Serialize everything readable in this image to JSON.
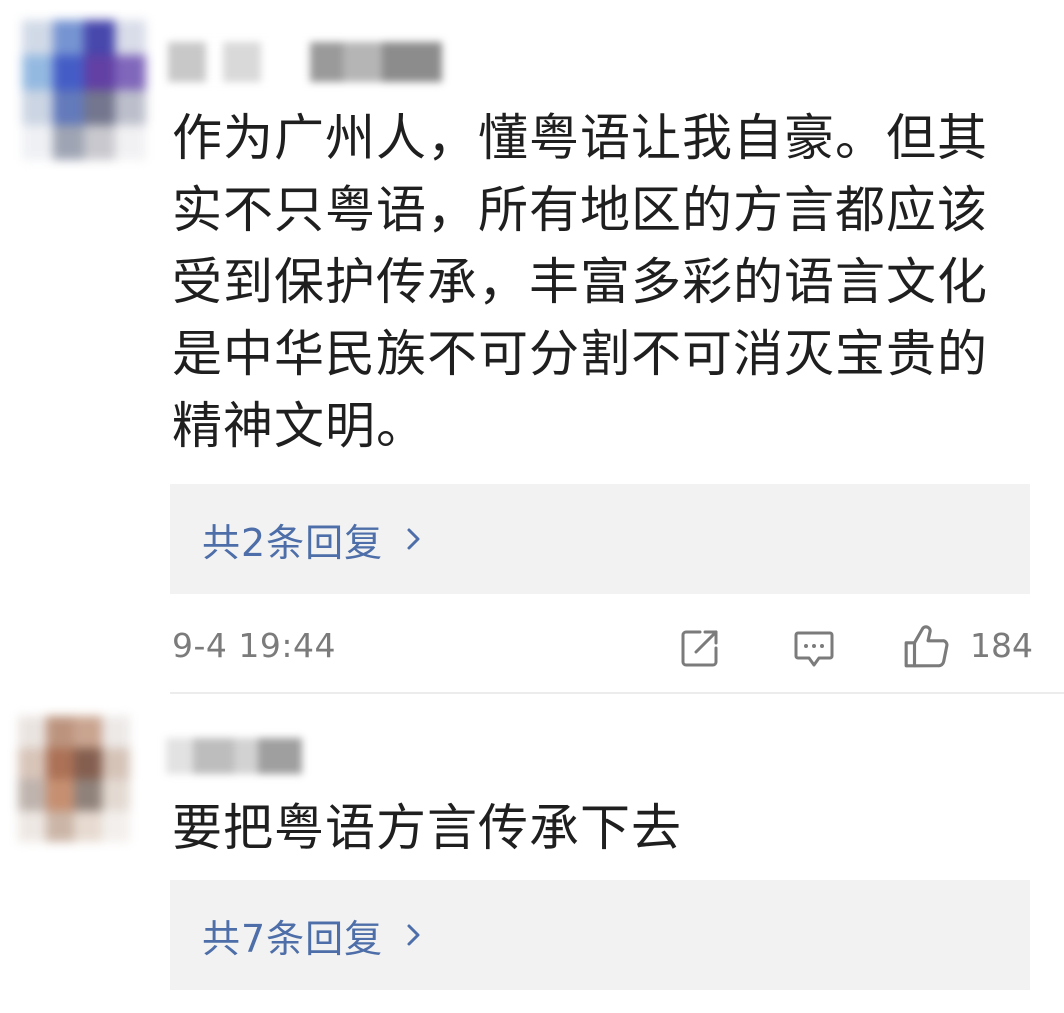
{
  "comments": [
    {
      "text": "作为广州人，懂粤语让我自豪。但其\n实不只粤语，所有地区的方言都应该\n受到保护传承，丰富多彩的语言文化\n是中华民族不可分割不可消灭宝贵的\n精神文明。",
      "replies_label": "共2条回复",
      "time": "9-4 19:44",
      "like_count": "184",
      "icons": {
        "share": "share-edit-icon",
        "comment": "comment-bubble-icon",
        "like": "thumbs-up-icon",
        "chevron": "chevron-right-icon"
      }
    },
    {
      "text": "要把粤语方言传承下去",
      "replies_label": "共7条回复"
    }
  ],
  "colors": {
    "reply_link": "#4d6ea8",
    "reply_bg": "#f2f2f2",
    "meta_gray": "#7b7b7b"
  }
}
